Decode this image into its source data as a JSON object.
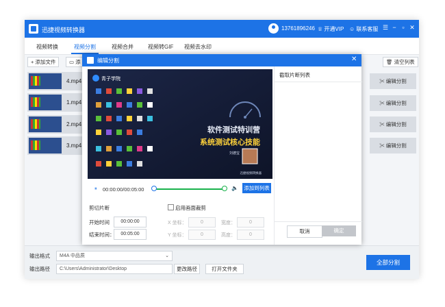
{
  "app": {
    "title": "迅捷视频转换器",
    "phone": "13761896246",
    "vip": "开通VIP",
    "service": "联系客服",
    "window_controls": [
      "☰",
      "−",
      "▫",
      "✕"
    ]
  },
  "tabs": [
    "视频转换",
    "视频分割",
    "视频合并",
    "视频转GIF",
    "视频去水印"
  ],
  "active_tab": "视频分割",
  "toolbar": {
    "add_file": "+ 添加文件",
    "add_folder": "添",
    "clear_list": "清空列表"
  },
  "files": [
    {
      "name": "4.mp4",
      "edit": "编辑分割"
    },
    {
      "name": "1.mp4",
      "edit": "编辑分割"
    },
    {
      "name": "2.mp4",
      "edit": "编辑分割"
    },
    {
      "name": "3.mp4",
      "edit": "编辑分割"
    }
  ],
  "bottom": {
    "format_label": "输出格式",
    "format_value": "M4A  中品质",
    "path_label": "输出路径",
    "path_value": "C:\\Users\\Administrator\\Desktop",
    "change_path": "更改路径",
    "open_folder": "打开文件夹",
    "split_all": "全部分割"
  },
  "dialog": {
    "title": "编辑分割",
    "close": "✕",
    "video": {
      "brand": "青子学院",
      "headline1": "软件测试特训营",
      "headline2": "系统测试核心技能",
      "presenter": "刘德宝",
      "footer_logo": "迅捷视频转换器"
    },
    "play_icon": "⏸",
    "timecode": "00:00:00/00:05:00",
    "progress_fraction": 1.0,
    "add_to_list": "添加到列表",
    "cut_title": "剪切片断",
    "start_label": "开始时间",
    "start_value": "00:00:00",
    "end_label": "结束时间：",
    "end_value": "00:05:00",
    "crop_label": "启用画面裁剪",
    "x_label": "X 坐标：",
    "y_label": "Y 坐标：",
    "w_label": "宽度：",
    "h_label": "高度：",
    "zero": "0",
    "list_title": "截取片断列表",
    "cancel": "取消",
    "ok": "确定"
  },
  "colors": {
    "accent": "#1d73e6",
    "progress": "#19b24b"
  }
}
